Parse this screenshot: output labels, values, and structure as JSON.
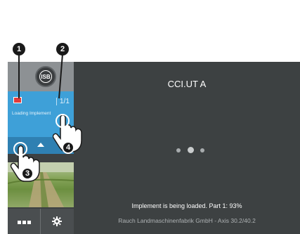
{
  "isb": {
    "label": "ISB"
  },
  "sidebar": {
    "page_count": "1/1",
    "loading_text": "Loading Implement",
    "implement_icon": "implement-icon"
  },
  "main": {
    "title": "CCI.UT A",
    "status": "Implement is being loaded. Part 1: 93%",
    "company": "Rauch Landmaschinenfabrik GmbH - Axis 30.2/40.2",
    "progress_percent": 93
  },
  "callouts": [
    "1",
    "2",
    "3",
    "4"
  ],
  "colors": {
    "terminal_bg": "#3d4142",
    "panel_blue": "#3ea0d8",
    "panel_blue_dark": "#2f80b2"
  },
  "icons": {
    "menu": "menu-dots-icon",
    "settings": "gear-icon",
    "up": "chevron-up-icon",
    "hand": "pointing-hand-icon"
  }
}
